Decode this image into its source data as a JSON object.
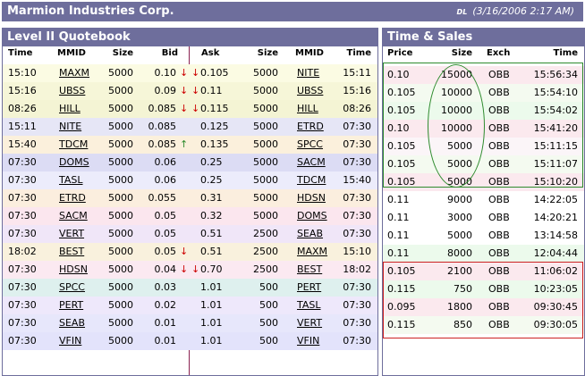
{
  "window": {
    "company": "Marmion Industries Corp.",
    "user": "DL",
    "datetime": "(3/16/2006 2:17 AM)"
  },
  "quotebook": {
    "title": "Level II Quotebook",
    "bid_headers": [
      "Time",
      "MMID",
      "Size",
      "Bid"
    ],
    "ask_headers": [
      "Ask",
      "Size",
      "MMID",
      "Time"
    ],
    "bids": [
      {
        "time": "15:10",
        "mmid": "MAXM",
        "size": "5000",
        "price": "0.10",
        "arrow": "down"
      },
      {
        "time": "15:16",
        "mmid": "UBSS",
        "size": "5000",
        "price": "0.09",
        "arrow": "down"
      },
      {
        "time": "08:26",
        "mmid": "HILL",
        "size": "5000",
        "price": "0.085",
        "arrow": "down"
      },
      {
        "time": "15:11",
        "mmid": "NITE",
        "size": "5000",
        "price": "0.085",
        "arrow": ""
      },
      {
        "time": "15:40",
        "mmid": "TDCM",
        "size": "5000",
        "price": "0.085",
        "arrow": "up"
      },
      {
        "time": "07:30",
        "mmid": "DOMS",
        "size": "5000",
        "price": "0.06",
        "arrow": ""
      },
      {
        "time": "07:30",
        "mmid": "TASL",
        "size": "5000",
        "price": "0.06",
        "arrow": ""
      },
      {
        "time": "07:30",
        "mmid": "ETRD",
        "size": "5000",
        "price": "0.055",
        "arrow": ""
      },
      {
        "time": "07:30",
        "mmid": "SACM",
        "size": "5000",
        "price": "0.05",
        "arrow": ""
      },
      {
        "time": "07:30",
        "mmid": "VERT",
        "size": "5000",
        "price": "0.05",
        "arrow": ""
      },
      {
        "time": "18:02",
        "mmid": "BEST",
        "size": "5000",
        "price": "0.05",
        "arrow": "down"
      },
      {
        "time": "07:30",
        "mmid": "HDSN",
        "size": "5000",
        "price": "0.04",
        "arrow": "down"
      },
      {
        "time": "07:30",
        "mmid": "SPCC",
        "size": "5000",
        "price": "0.03",
        "arrow": ""
      },
      {
        "time": "07:30",
        "mmid": "PERT",
        "size": "5000",
        "price": "0.02",
        "arrow": ""
      },
      {
        "time": "07:30",
        "mmid": "SEAB",
        "size": "5000",
        "price": "0.01",
        "arrow": ""
      },
      {
        "time": "07:30",
        "mmid": "VFIN",
        "size": "5000",
        "price": "0.01",
        "arrow": ""
      }
    ],
    "asks": [
      {
        "price": "0.105",
        "size": "5000",
        "mmid": "NITE",
        "time": "15:11"
      },
      {
        "price": "0.11",
        "size": "5000",
        "mmid": "UBSS",
        "time": "15:16"
      },
      {
        "price": "0.115",
        "size": "5000",
        "mmid": "HILL",
        "time": "08:26"
      },
      {
        "price": "0.125",
        "size": "5000",
        "mmid": "ETRD",
        "time": "07:30"
      },
      {
        "price": "0.135",
        "size": "5000",
        "mmid": "SPCC",
        "time": "07:30"
      },
      {
        "price": "0.25",
        "size": "5000",
        "mmid": "SACM",
        "time": "07:30"
      },
      {
        "price": "0.25",
        "size": "5000",
        "mmid": "TDCM",
        "time": "15:40"
      },
      {
        "price": "0.31",
        "size": "5000",
        "mmid": "HDSN",
        "time": "07:30"
      },
      {
        "price": "0.32",
        "size": "5000",
        "mmid": "DOMS",
        "time": "07:30"
      },
      {
        "price": "0.51",
        "size": "2500",
        "mmid": "SEAB",
        "time": "07:30"
      },
      {
        "price": "0.51",
        "size": "2500",
        "mmid": "MAXM",
        "time": "15:10"
      },
      {
        "price": "0.70",
        "size": "2500",
        "mmid": "BEST",
        "time": "18:02"
      },
      {
        "price": "1.01",
        "size": "500",
        "mmid": "PERT",
        "time": "07:30"
      },
      {
        "price": "1.01",
        "size": "500",
        "mmid": "TASL",
        "time": "07:30"
      },
      {
        "price": "1.01",
        "size": "500",
        "mmid": "VERT",
        "time": "07:30"
      },
      {
        "price": "1.01",
        "size": "500",
        "mmid": "VFIN",
        "time": "07:30"
      }
    ],
    "ask_arrow_rows": [
      0,
      1,
      2,
      11
    ]
  },
  "time_sales": {
    "title": "Time & Sales",
    "headers": [
      "Price",
      "Size",
      "Exch",
      "Time"
    ],
    "trades": [
      {
        "price": "0.10",
        "size": "15000",
        "exch": "OBB",
        "time": "15:56:34"
      },
      {
        "price": "0.105",
        "size": "10000",
        "exch": "OBB",
        "time": "15:54:10"
      },
      {
        "price": "0.105",
        "size": "10000",
        "exch": "OBB",
        "time": "15:54:02"
      },
      {
        "price": "0.10",
        "size": "10000",
        "exch": "OBB",
        "time": "15:41:20"
      },
      {
        "price": "0.105",
        "size": "5000",
        "exch": "OBB",
        "time": "15:11:15"
      },
      {
        "price": "0.105",
        "size": "5000",
        "exch": "OBB",
        "time": "15:11:07"
      },
      {
        "price": "0.105",
        "size": "5000",
        "exch": "OBB",
        "time": "15:10:20"
      },
      {
        "price": "0.11",
        "size": "9000",
        "exch": "OBB",
        "time": "14:22:05"
      },
      {
        "price": "0.11",
        "size": "3000",
        "exch": "OBB",
        "time": "14:20:21"
      },
      {
        "price": "0.11",
        "size": "5000",
        "exch": "OBB",
        "time": "13:14:58"
      },
      {
        "price": "0.11",
        "size": "8000",
        "exch": "OBB",
        "time": "12:04:44"
      },
      {
        "price": "0.105",
        "size": "2100",
        "exch": "OBB",
        "time": "11:06:02"
      },
      {
        "price": "0.115",
        "size": "750",
        "exch": "OBB",
        "time": "10:23:05"
      },
      {
        "price": "0.095",
        "size": "1800",
        "exch": "OBB",
        "time": "09:30:45"
      },
      {
        "price": "0.115",
        "size": "850",
        "exch": "OBB",
        "time": "09:30:05"
      }
    ]
  },
  "colors": {
    "header_bg": "#6e6e9c",
    "row_bg": [
      "#fbfbe3",
      "#f6f6d8",
      "#f4f4d4",
      "#e6e6f6",
      "#fbf0dc",
      "#dcdcf4",
      "#ececfb",
      "#fbeede",
      "#fbe6ee",
      "#f0e6f8",
      "#f9f1dd",
      "#fbe9f1",
      "#def0ee",
      "#eee8fb",
      "#e7e7fb",
      "#e3e3fb"
    ],
    "ts_row_bg": [
      "#fbe9ee",
      "#f4faf0",
      "#ecfaec",
      "#fbe9ee",
      "#fbf5f8",
      "#f4faf0",
      "#fbe9ee",
      "#ffffff",
      "#ffffff",
      "#ffffff",
      "#ecfaec",
      "#fbe9ee",
      "#ecfaec",
      "#fbe9ee",
      "#f4faf0"
    ],
    "green_box": "#2e8b2e",
    "red_box": "#cc2222",
    "divider": "#8b2252"
  }
}
